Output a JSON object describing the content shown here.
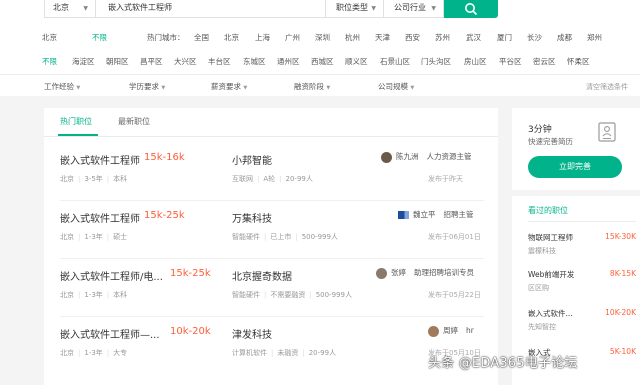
{
  "search": {
    "city": "北京",
    "keyword": "嵌入式软件工程师",
    "position_type": "职位类型",
    "industry": "公司行业"
  },
  "filters": {
    "city_row": [
      "北京",
      "不限",
      "热门城市：",
      "全国",
      "北京",
      "上海",
      "广州",
      "深圳",
      "杭州",
      "天津",
      "西安",
      "苏州",
      "武汉",
      "厦门",
      "长沙",
      "成都",
      "郑州"
    ],
    "district_row": [
      "不限",
      "海淀区",
      "朝阳区",
      "昌平区",
      "大兴区",
      "丰台区",
      "东城区",
      "通州区",
      "西城区",
      "顺义区",
      "石景山区",
      "门头沟区",
      "房山区",
      "平谷区",
      "密云区",
      "怀柔区"
    ],
    "more_row": [
      "工作经验",
      "学历要求",
      "薪资要求",
      "融资阶段",
      "公司规模"
    ],
    "clear": "清空筛选条件"
  },
  "tabs": [
    "热门职位",
    "最新职位"
  ],
  "jobs": [
    {
      "title": "嵌入式软件工程师",
      "salary": "15k-16k",
      "city": "北京",
      "exp": "3-5年",
      "edu": "本科",
      "company": "小邦智能",
      "industry": "互联网",
      "stage": "A轮",
      "size": "20-99人",
      "hr_name": "陈九洲",
      "hr_title": "人力资源主管",
      "date": "发布于昨天"
    },
    {
      "title": "嵌入式软件工程师",
      "salary": "15k-25k",
      "city": "北京",
      "exp": "1-3年",
      "edu": "硕士",
      "company": "万集科技",
      "industry": "智能硬件",
      "stage": "已上市",
      "size": "500-999人",
      "hr_name": "魏立平",
      "hr_title": "招聘主管",
      "date": "发布于06月01日"
    },
    {
      "title": "嵌入式软件工程师/电...",
      "salary": "15k-25k",
      "city": "北京",
      "exp": "1-3年",
      "edu": "本科",
      "company": "北京握奇数据",
      "industry": "智能硬件",
      "stage": "不需要融资",
      "size": "500-999人",
      "hr_name": "张婷",
      "hr_title": "助理招聘培训专员",
      "date": "发布于05月22日"
    },
    {
      "title": "嵌入式软件工程师—...",
      "salary": "10k-20k",
      "city": "北京",
      "exp": "1-3年",
      "edu": "大专",
      "company": "津发科技",
      "industry": "计算机软件",
      "stage": "未融资",
      "size": "20-99人",
      "hr_name": "周婷",
      "hr_title": "hr",
      "date": "发布于05月10日"
    }
  ],
  "resume_card": {
    "title": "3分钟",
    "subtitle": "快速完善简历",
    "button": "立即完善"
  },
  "viewed": {
    "heading": "看过的职位",
    "items": [
      {
        "name": "物联网工程师",
        "salary": "15K-30K",
        "company": "震檬科技"
      },
      {
        "name": "Web前端开发",
        "salary": "8K-15K",
        "company": "区区购"
      },
      {
        "name": "嵌入式软件...",
        "salary": "10K-20K",
        "company": "先知智控"
      },
      {
        "name": "嵌入式",
        "salary": "5K-10K",
        "company": ""
      }
    ]
  },
  "watermark": "头条 @EDA365电子论坛",
  "colors": {
    "accent": "#00b38a",
    "salary": "#fd5f39"
  }
}
